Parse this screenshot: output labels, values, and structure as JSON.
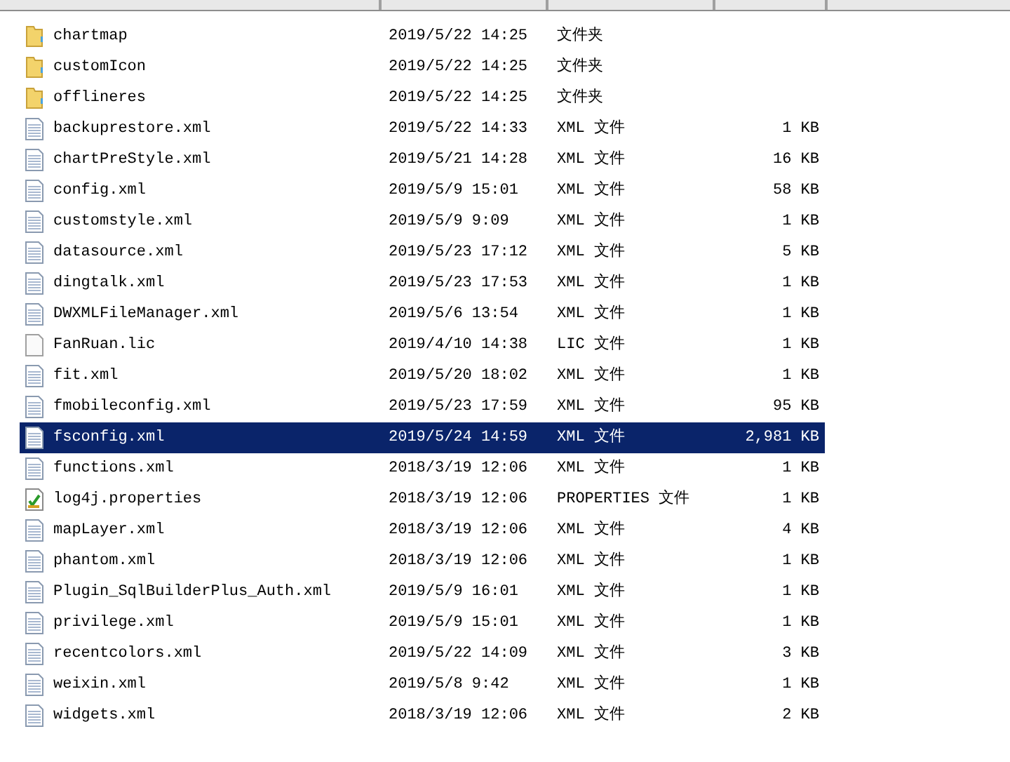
{
  "table": {
    "rows": [
      {
        "kind": "folder",
        "name": "chartmap",
        "date": "2019/5/22 14:25",
        "type": "文件夹",
        "size": "",
        "selected": false
      },
      {
        "kind": "folder",
        "name": "customIcon",
        "date": "2019/5/22 14:25",
        "type": "文件夹",
        "size": "",
        "selected": false
      },
      {
        "kind": "folder",
        "name": "offlineres",
        "date": "2019/5/22 14:25",
        "type": "文件夹",
        "size": "",
        "selected": false
      },
      {
        "kind": "document",
        "name": "backuprestore.xml",
        "date": "2019/5/22 14:33",
        "type": "XML 文件",
        "size": "1 KB",
        "selected": false
      },
      {
        "kind": "document",
        "name": "chartPreStyle.xml",
        "date": "2019/5/21 14:28",
        "type": "XML 文件",
        "size": "16 KB",
        "selected": false
      },
      {
        "kind": "document",
        "name": "config.xml",
        "date": "2019/5/9 15:01",
        "type": "XML 文件",
        "size": "58 KB",
        "selected": false
      },
      {
        "kind": "document",
        "name": "customstyle.xml",
        "date": "2019/5/9 9:09",
        "type": "XML 文件",
        "size": "1 KB",
        "selected": false
      },
      {
        "kind": "document",
        "name": "datasource.xml",
        "date": "2019/5/23 17:12",
        "type": "XML 文件",
        "size": "5 KB",
        "selected": false
      },
      {
        "kind": "document",
        "name": "dingtalk.xml",
        "date": "2019/5/23 17:53",
        "type": "XML 文件",
        "size": "1 KB",
        "selected": false
      },
      {
        "kind": "document",
        "name": "DWXMLFileManager.xml",
        "date": "2019/5/6 13:54",
        "type": "XML 文件",
        "size": "1 KB",
        "selected": false
      },
      {
        "kind": "blank",
        "name": "FanRuan.lic",
        "date": "2019/4/10 14:38",
        "type": "LIC 文件",
        "size": "1 KB",
        "selected": false
      },
      {
        "kind": "document",
        "name": "fit.xml",
        "date": "2019/5/20 18:02",
        "type": "XML 文件",
        "size": "1 KB",
        "selected": false
      },
      {
        "kind": "document",
        "name": "fmobileconfig.xml",
        "date": "2019/5/23 17:59",
        "type": "XML 文件",
        "size": "95 KB",
        "selected": false
      },
      {
        "kind": "document",
        "name": "fsconfig.xml",
        "date": "2019/5/24 14:59",
        "type": "XML 文件",
        "size": "2,981 KB",
        "selected": true
      },
      {
        "kind": "document",
        "name": "functions.xml",
        "date": "2018/3/19 12:06",
        "type": "XML 文件",
        "size": "1 KB",
        "selected": false
      },
      {
        "kind": "properties",
        "name": "log4j.properties",
        "date": "2018/3/19 12:06",
        "type": "PROPERTIES 文件",
        "size": "1 KB",
        "selected": false
      },
      {
        "kind": "document",
        "name": "mapLayer.xml",
        "date": "2018/3/19 12:06",
        "type": "XML 文件",
        "size": "4 KB",
        "selected": false
      },
      {
        "kind": "document",
        "name": "phantom.xml",
        "date": "2018/3/19 12:06",
        "type": "XML 文件",
        "size": "1 KB",
        "selected": false
      },
      {
        "kind": "document",
        "name": "Plugin_SqlBuilderPlus_Auth.xml",
        "date": "2019/5/9 16:01",
        "type": "XML 文件",
        "size": "1 KB",
        "selected": false
      },
      {
        "kind": "document",
        "name": "privilege.xml",
        "date": "2019/5/9 15:01",
        "type": "XML 文件",
        "size": "1 KB",
        "selected": false
      },
      {
        "kind": "document",
        "name": "recentcolors.xml",
        "date": "2019/5/22 14:09",
        "type": "XML 文件",
        "size": "3 KB",
        "selected": false
      },
      {
        "kind": "document",
        "name": "weixin.xml",
        "date": "2019/5/8 9:42",
        "type": "XML 文件",
        "size": "1 KB",
        "selected": false
      },
      {
        "kind": "document",
        "name": "widgets.xml",
        "date": "2018/3/19 12:06",
        "type": "XML 文件",
        "size": "2 KB",
        "selected": false
      }
    ]
  }
}
